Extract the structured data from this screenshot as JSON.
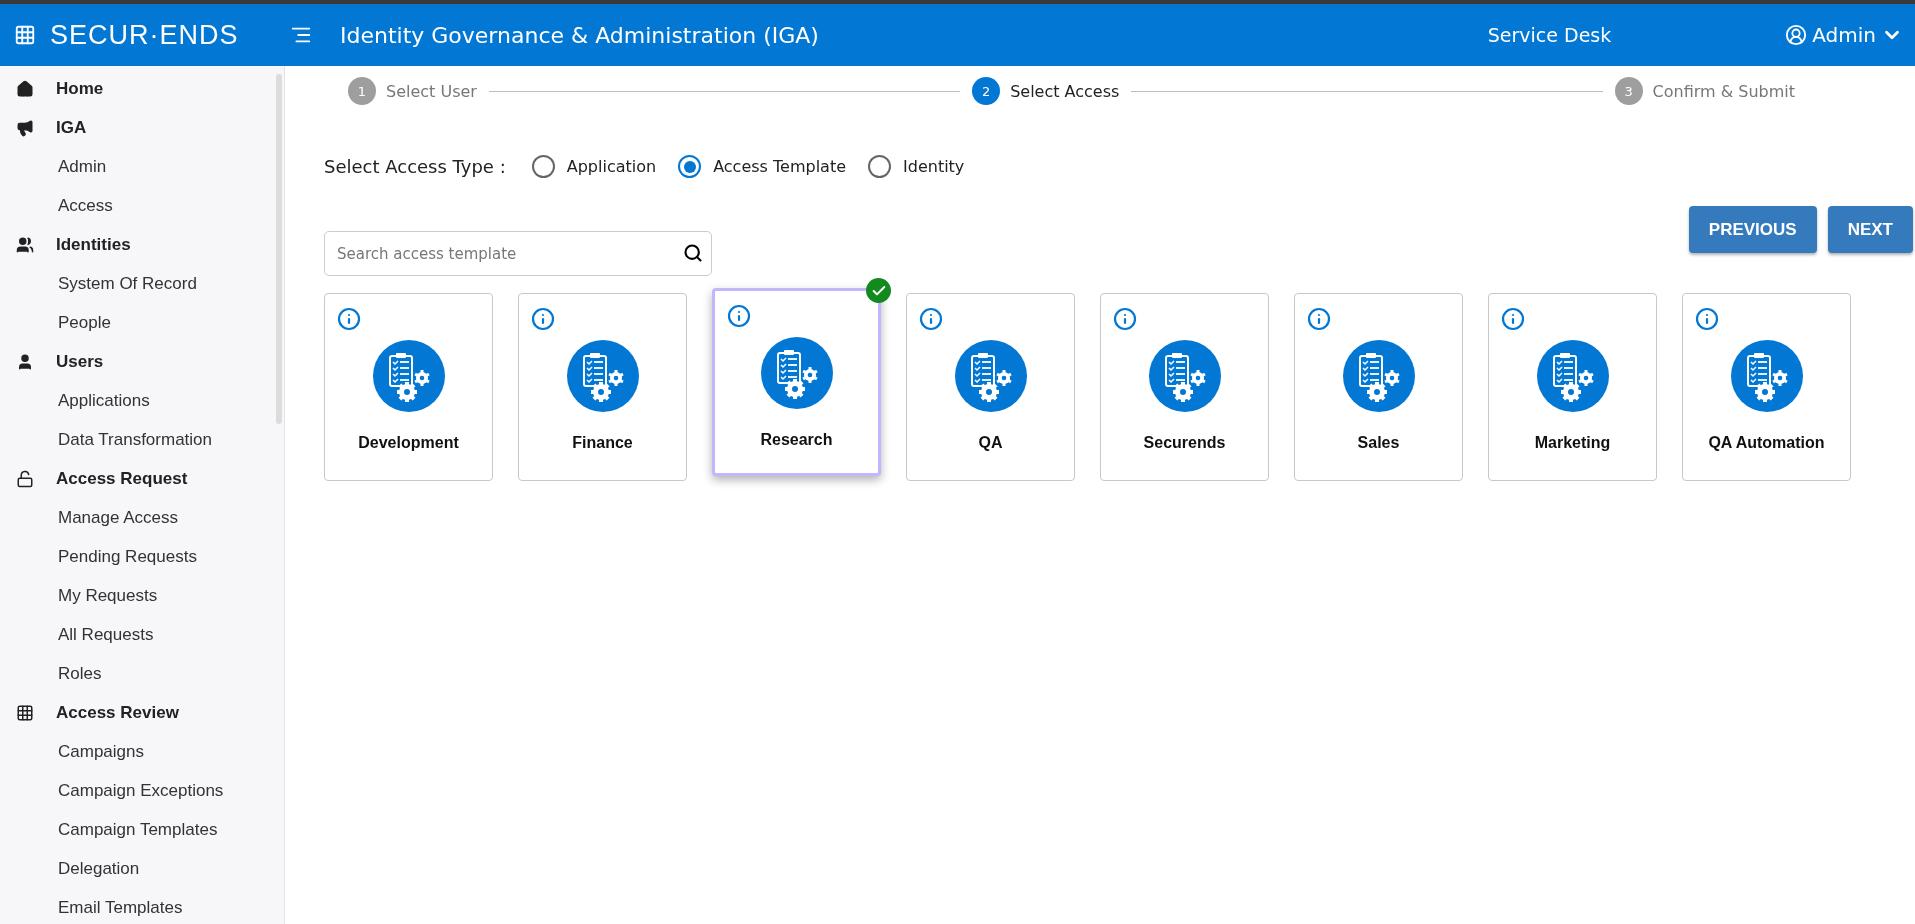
{
  "header": {
    "logo": "SECUR·ENDS",
    "title": "Identity Governance & Administration (IGA)",
    "service_desk": "Service Desk",
    "user": "Admin"
  },
  "sidebar": {
    "sections": [
      {
        "label": "Home"
      },
      {
        "label": "IGA",
        "children": [
          "Admin",
          "Access"
        ]
      },
      {
        "label": "Identities",
        "children": [
          "System Of Record",
          "People"
        ]
      },
      {
        "label": "Users",
        "children": [
          "Applications",
          "Data Transformation"
        ]
      },
      {
        "label": "Access Request",
        "children": [
          "Manage Access",
          "Pending Requests",
          "My Requests",
          "All Requests",
          "Roles"
        ]
      },
      {
        "label": "Access Review",
        "children": [
          "Campaigns",
          "Campaign Exceptions",
          "Campaign Templates",
          "Delegation",
          "Email Templates"
        ]
      }
    ]
  },
  "stepper": [
    {
      "number": "1",
      "label": "Select User",
      "selected": false
    },
    {
      "number": "2",
      "label": "Select Access",
      "selected": true
    },
    {
      "number": "3",
      "label": "Confirm & Submit",
      "selected": false
    }
  ],
  "access_type": {
    "label": "Select Access Type :",
    "options": [
      {
        "label": "Application",
        "selected": false
      },
      {
        "label": "Access Template",
        "selected": true
      },
      {
        "label": "Identity",
        "selected": false
      }
    ]
  },
  "search": {
    "placeholder": "Search access template"
  },
  "buttons": [
    "PREVIOUS",
    "NEXT"
  ],
  "templates": [
    {
      "label": "Development",
      "selected": false
    },
    {
      "label": "Finance",
      "selected": false
    },
    {
      "label": "Research",
      "selected": true
    },
    {
      "label": "QA",
      "selected": false
    },
    {
      "label": "Securends",
      "selected": false
    },
    {
      "label": "Sales",
      "selected": false
    },
    {
      "label": "Marketing",
      "selected": false
    },
    {
      "label": "QA Automation",
      "selected": false
    }
  ]
}
